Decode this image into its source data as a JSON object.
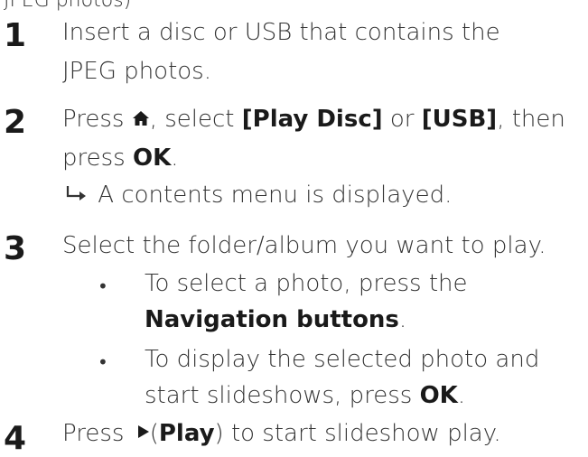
{
  "top_fragment": "JPEG photos)",
  "steps": [
    {
      "number": "1",
      "lines": [
        "Insert a disc or USB that contains the",
        "JPEG photos."
      ]
    },
    {
      "number": "2",
      "press": "Press",
      "select": ", select",
      "play_disc": "[Play Disc]",
      "or": "or",
      "usb": "[USB]",
      "then": ", then",
      "press2": "press",
      "ok": "OK",
      "period": ".",
      "result": "A contents menu is displayed."
    },
    {
      "number": "3",
      "line": "Select the folder/album you want to play.",
      "bullets": [
        {
          "line1": "To select a photo, press the",
          "line2_bold": "Navigation buttons",
          "line2_end": "."
        },
        {
          "line1": "To display the selected photo and",
          "line2": "start slideshows, press",
          "line2_bold": "OK",
          "line2_end": "."
        }
      ]
    },
    {
      "number": "4",
      "press": "Press",
      "open_paren": "(",
      "play": "Play",
      "rest": ") to start slideshow play."
    }
  ],
  "icons": {
    "home": "home-icon",
    "result_arrow": "result-arrow-icon",
    "play": "play-icon",
    "bullet": "bullet-dot"
  },
  "colors": {
    "text": "#333333",
    "number": "#1a1a1a"
  }
}
